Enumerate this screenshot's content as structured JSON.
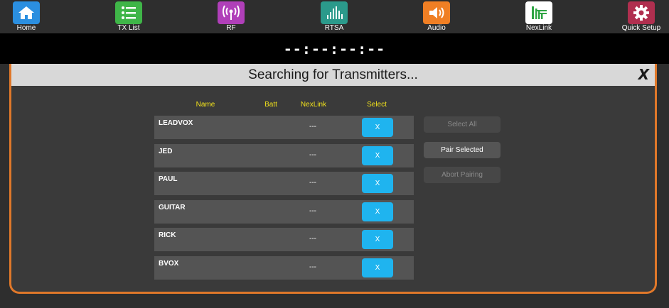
{
  "nav": [
    {
      "label": "Home",
      "icon": "home-icon",
      "color": "#2b8fe0"
    },
    {
      "label": "TX List",
      "icon": "list-icon",
      "color": "#3fb548"
    },
    {
      "label": "RF",
      "icon": "antenna-icon",
      "color": "#b03fb9"
    },
    {
      "label": "RTSA",
      "icon": "spectrum-icon",
      "color": "#2b9a8b"
    },
    {
      "label": "Audio",
      "icon": "speaker-icon",
      "color": "#f07f24"
    },
    {
      "label": "NexLink",
      "icon": "nexlink-icon",
      "color": "#ffffff"
    },
    {
      "label": "Quick Setup",
      "icon": "gear-icon",
      "color": "#b02f4f"
    }
  ],
  "clock": "--:--:--:--",
  "dialog": {
    "title": "Searching for Transmitters...",
    "close_label": "X",
    "accent_color": "#e0782a",
    "columns": {
      "name": "Name",
      "batt": "Batt",
      "nexlink": "NexLink",
      "select": "Select"
    },
    "rows": [
      {
        "name": "LEADVOX",
        "batt": "",
        "nexlink": "---",
        "select": "X"
      },
      {
        "name": "JED",
        "batt": "",
        "nexlink": "---",
        "select": "X"
      },
      {
        "name": "PAUL",
        "batt": "",
        "nexlink": "---",
        "select": "X"
      },
      {
        "name": "GUITAR",
        "batt": "",
        "nexlink": "---",
        "select": "X"
      },
      {
        "name": "RICK",
        "batt": "",
        "nexlink": "---",
        "select": "X"
      },
      {
        "name": "BVOX",
        "batt": "",
        "nexlink": "---",
        "select": "X"
      }
    ],
    "buttons": {
      "select_all": "Select All",
      "pair_selected": "Pair Selected",
      "abort_pairing": "Abort Pairing"
    }
  }
}
